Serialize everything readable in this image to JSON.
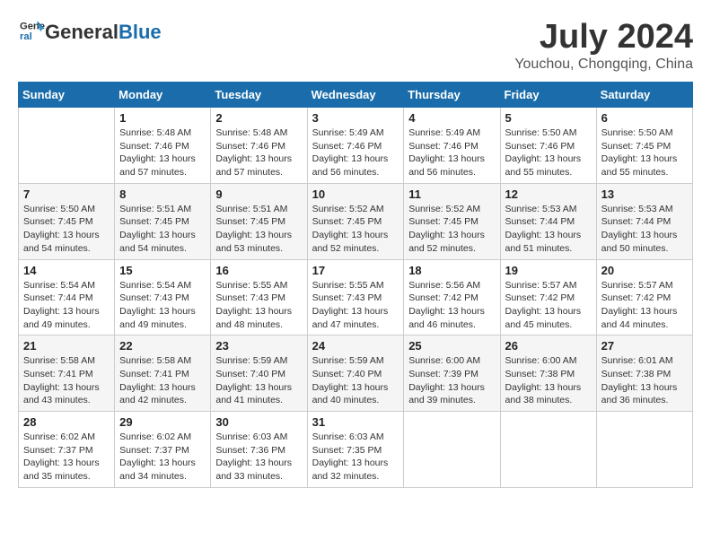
{
  "header": {
    "logo_line1": "General",
    "logo_line2": "Blue",
    "month_year": "July 2024",
    "location": "Youchou, Chongqing, China"
  },
  "weekdays": [
    "Sunday",
    "Monday",
    "Tuesday",
    "Wednesday",
    "Thursday",
    "Friday",
    "Saturday"
  ],
  "weeks": [
    [
      {
        "day": "",
        "sunrise": "",
        "sunset": "",
        "daylight": ""
      },
      {
        "day": "1",
        "sunrise": "Sunrise: 5:48 AM",
        "sunset": "Sunset: 7:46 PM",
        "daylight": "Daylight: 13 hours and 57 minutes."
      },
      {
        "day": "2",
        "sunrise": "Sunrise: 5:48 AM",
        "sunset": "Sunset: 7:46 PM",
        "daylight": "Daylight: 13 hours and 57 minutes."
      },
      {
        "day": "3",
        "sunrise": "Sunrise: 5:49 AM",
        "sunset": "Sunset: 7:46 PM",
        "daylight": "Daylight: 13 hours and 56 minutes."
      },
      {
        "day": "4",
        "sunrise": "Sunrise: 5:49 AM",
        "sunset": "Sunset: 7:46 PM",
        "daylight": "Daylight: 13 hours and 56 minutes."
      },
      {
        "day": "5",
        "sunrise": "Sunrise: 5:50 AM",
        "sunset": "Sunset: 7:46 PM",
        "daylight": "Daylight: 13 hours and 55 minutes."
      },
      {
        "day": "6",
        "sunrise": "Sunrise: 5:50 AM",
        "sunset": "Sunset: 7:45 PM",
        "daylight": "Daylight: 13 hours and 55 minutes."
      }
    ],
    [
      {
        "day": "7",
        "sunrise": "Sunrise: 5:50 AM",
        "sunset": "Sunset: 7:45 PM",
        "daylight": "Daylight: 13 hours and 54 minutes."
      },
      {
        "day": "8",
        "sunrise": "Sunrise: 5:51 AM",
        "sunset": "Sunset: 7:45 PM",
        "daylight": "Daylight: 13 hours and 54 minutes."
      },
      {
        "day": "9",
        "sunrise": "Sunrise: 5:51 AM",
        "sunset": "Sunset: 7:45 PM",
        "daylight": "Daylight: 13 hours and 53 minutes."
      },
      {
        "day": "10",
        "sunrise": "Sunrise: 5:52 AM",
        "sunset": "Sunset: 7:45 PM",
        "daylight": "Daylight: 13 hours and 52 minutes."
      },
      {
        "day": "11",
        "sunrise": "Sunrise: 5:52 AM",
        "sunset": "Sunset: 7:45 PM",
        "daylight": "Daylight: 13 hours and 52 minutes."
      },
      {
        "day": "12",
        "sunrise": "Sunrise: 5:53 AM",
        "sunset": "Sunset: 7:44 PM",
        "daylight": "Daylight: 13 hours and 51 minutes."
      },
      {
        "day": "13",
        "sunrise": "Sunrise: 5:53 AM",
        "sunset": "Sunset: 7:44 PM",
        "daylight": "Daylight: 13 hours and 50 minutes."
      }
    ],
    [
      {
        "day": "14",
        "sunrise": "Sunrise: 5:54 AM",
        "sunset": "Sunset: 7:44 PM",
        "daylight": "Daylight: 13 hours and 49 minutes."
      },
      {
        "day": "15",
        "sunrise": "Sunrise: 5:54 AM",
        "sunset": "Sunset: 7:43 PM",
        "daylight": "Daylight: 13 hours and 49 minutes."
      },
      {
        "day": "16",
        "sunrise": "Sunrise: 5:55 AM",
        "sunset": "Sunset: 7:43 PM",
        "daylight": "Daylight: 13 hours and 48 minutes."
      },
      {
        "day": "17",
        "sunrise": "Sunrise: 5:55 AM",
        "sunset": "Sunset: 7:43 PM",
        "daylight": "Daylight: 13 hours and 47 minutes."
      },
      {
        "day": "18",
        "sunrise": "Sunrise: 5:56 AM",
        "sunset": "Sunset: 7:42 PM",
        "daylight": "Daylight: 13 hours and 46 minutes."
      },
      {
        "day": "19",
        "sunrise": "Sunrise: 5:57 AM",
        "sunset": "Sunset: 7:42 PM",
        "daylight": "Daylight: 13 hours and 45 minutes."
      },
      {
        "day": "20",
        "sunrise": "Sunrise: 5:57 AM",
        "sunset": "Sunset: 7:42 PM",
        "daylight": "Daylight: 13 hours and 44 minutes."
      }
    ],
    [
      {
        "day": "21",
        "sunrise": "Sunrise: 5:58 AM",
        "sunset": "Sunset: 7:41 PM",
        "daylight": "Daylight: 13 hours and 43 minutes."
      },
      {
        "day": "22",
        "sunrise": "Sunrise: 5:58 AM",
        "sunset": "Sunset: 7:41 PM",
        "daylight": "Daylight: 13 hours and 42 minutes."
      },
      {
        "day": "23",
        "sunrise": "Sunrise: 5:59 AM",
        "sunset": "Sunset: 7:40 PM",
        "daylight": "Daylight: 13 hours and 41 minutes."
      },
      {
        "day": "24",
        "sunrise": "Sunrise: 5:59 AM",
        "sunset": "Sunset: 7:40 PM",
        "daylight": "Daylight: 13 hours and 40 minutes."
      },
      {
        "day": "25",
        "sunrise": "Sunrise: 6:00 AM",
        "sunset": "Sunset: 7:39 PM",
        "daylight": "Daylight: 13 hours and 39 minutes."
      },
      {
        "day": "26",
        "sunrise": "Sunrise: 6:00 AM",
        "sunset": "Sunset: 7:38 PM",
        "daylight": "Daylight: 13 hours and 38 minutes."
      },
      {
        "day": "27",
        "sunrise": "Sunrise: 6:01 AM",
        "sunset": "Sunset: 7:38 PM",
        "daylight": "Daylight: 13 hours and 36 minutes."
      }
    ],
    [
      {
        "day": "28",
        "sunrise": "Sunrise: 6:02 AM",
        "sunset": "Sunset: 7:37 PM",
        "daylight": "Daylight: 13 hours and 35 minutes."
      },
      {
        "day": "29",
        "sunrise": "Sunrise: 6:02 AM",
        "sunset": "Sunset: 7:37 PM",
        "daylight": "Daylight: 13 hours and 34 minutes."
      },
      {
        "day": "30",
        "sunrise": "Sunrise: 6:03 AM",
        "sunset": "Sunset: 7:36 PM",
        "daylight": "Daylight: 13 hours and 33 minutes."
      },
      {
        "day": "31",
        "sunrise": "Sunrise: 6:03 AM",
        "sunset": "Sunset: 7:35 PM",
        "daylight": "Daylight: 13 hours and 32 minutes."
      },
      {
        "day": "",
        "sunrise": "",
        "sunset": "",
        "daylight": ""
      },
      {
        "day": "",
        "sunrise": "",
        "sunset": "",
        "daylight": ""
      },
      {
        "day": "",
        "sunrise": "",
        "sunset": "",
        "daylight": ""
      }
    ]
  ]
}
